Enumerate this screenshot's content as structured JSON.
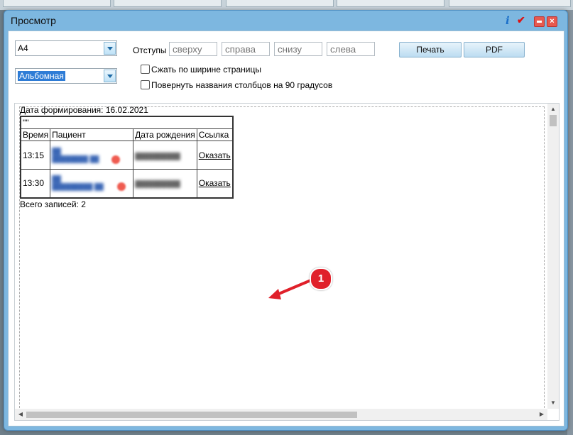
{
  "window": {
    "title": "Просмотр"
  },
  "toolbar": {
    "paper_size": "A4",
    "orientation": "Альбомная",
    "margins_label": "Отступы",
    "margin_placeholders": {
      "top": "сверху",
      "right": "справа",
      "bottom": "снизу",
      "left": "слева"
    },
    "print_label": "Печать",
    "pdf_label": "PDF",
    "fit_width_label": "Сжать по ширине страницы",
    "rotate_headers_label": "Повернуть названия столбцов на 90 градусов"
  },
  "report": {
    "date_line": "Дата формирования: 16.02.2021",
    "title_row": "\"\"",
    "columns": [
      "Время",
      "Пациент",
      "Дата рождения",
      "Ссылка"
    ],
    "rows": [
      {
        "time": "13:15",
        "link": "Оказать"
      },
      {
        "time": "13:30",
        "link": "Оказать"
      }
    ],
    "total": "Всего записей: 2"
  },
  "annotation": {
    "marker": "1"
  },
  "colors": {
    "window_frame": "#7db7e0",
    "marker": "#e0202a",
    "selection": "#2e7cd6"
  }
}
